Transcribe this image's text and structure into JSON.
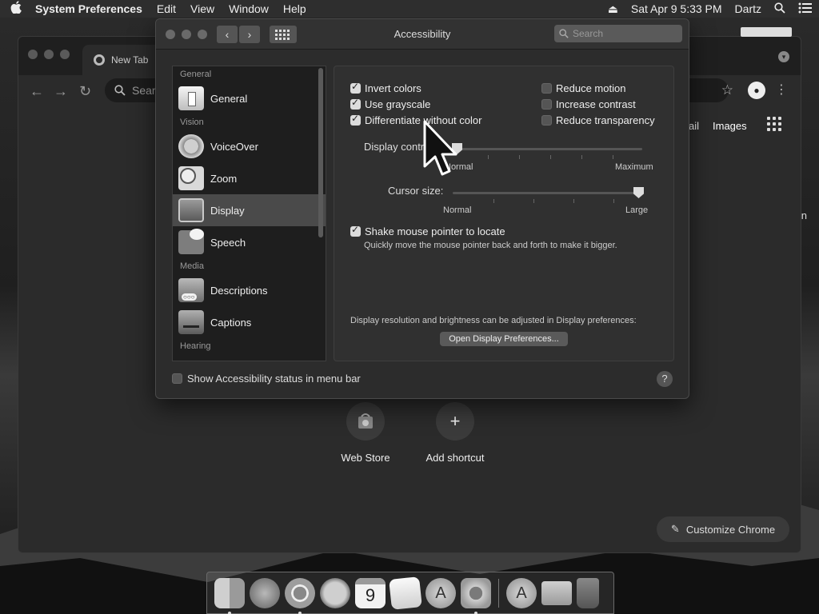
{
  "menubar": {
    "app_name": "System Preferences",
    "menus": [
      "Edit",
      "View",
      "Window",
      "Help"
    ],
    "datetime": "Sat Apr 9  5:33 PM",
    "user": "Dartz"
  },
  "chrome": {
    "tab_title": "New Tab",
    "omnibox_placeholder": "Sear",
    "gmail_partial": "ail",
    "images_link": "Images",
    "edge_fragment": "n",
    "shortcuts": [
      {
        "label": "Web Store",
        "icon": "web-store-icon"
      },
      {
        "label": "Add shortcut",
        "icon": "plus-icon",
        "glyph": "+"
      }
    ],
    "customize_label": "Customize Chrome"
  },
  "prefs": {
    "window_title": "Accessibility",
    "search_placeholder": "Search",
    "sidebar": [
      {
        "type": "header",
        "label": "General"
      },
      {
        "type": "item",
        "label": "General",
        "icon": "general-icon",
        "selected": false
      },
      {
        "type": "header",
        "label": "Vision"
      },
      {
        "type": "item",
        "label": "VoiceOver",
        "icon": "voiceover-icon",
        "selected": false
      },
      {
        "type": "item",
        "label": "Zoom",
        "icon": "zoom-icon",
        "selected": false
      },
      {
        "type": "item",
        "label": "Display",
        "icon": "display-icon",
        "selected": true
      },
      {
        "type": "item",
        "label": "Speech",
        "icon": "speech-icon",
        "selected": false
      },
      {
        "type": "header",
        "label": "Media"
      },
      {
        "type": "item",
        "label": "Descriptions",
        "icon": "descriptions-icon",
        "selected": false
      },
      {
        "type": "item",
        "label": "Captions",
        "icon": "captions-icon",
        "selected": false
      },
      {
        "type": "header",
        "label": "Hearing"
      }
    ],
    "options_left": [
      {
        "label": "Invert colors",
        "checked": true
      },
      {
        "label": "Use grayscale",
        "checked": true
      },
      {
        "label": "Differentiate without color",
        "checked": true
      }
    ],
    "options_right": [
      {
        "label": "Reduce motion",
        "checked": false
      },
      {
        "label": "Increase contrast",
        "checked": false
      },
      {
        "label": "Reduce transparency",
        "checked": false
      }
    ],
    "display_contrast": {
      "label": "Display contrast:",
      "min_label": "Normal",
      "max_label": "Maximum",
      "value": 0.0
    },
    "cursor_size": {
      "label": "Cursor size:",
      "min_label": "Normal",
      "max_label": "Large",
      "value": 1.0
    },
    "shake": {
      "label": "Shake mouse pointer to locate",
      "checked": true,
      "description": "Quickly move the mouse pointer back and forth to make it bigger."
    },
    "resolution_note": "Display resolution and brightness can be adjusted in Display preferences:",
    "open_display_button": "Open Display Preferences...",
    "status_menu": {
      "label": "Show Accessibility status in menu bar",
      "checked": false
    },
    "help_glyph": "?"
  },
  "dock": {
    "apps": [
      {
        "name": "finder-icon",
        "running": true
      },
      {
        "name": "launchpad-icon",
        "running": false
      },
      {
        "name": "chrome-icon",
        "running": true
      },
      {
        "name": "safari-icon",
        "running": false
      },
      {
        "name": "calendar-icon",
        "running": false,
        "text": "9"
      },
      {
        "name": "notes-icon",
        "running": false
      },
      {
        "name": "app-store-icon",
        "running": false
      },
      {
        "name": "system-preferences-icon",
        "running": true
      }
    ],
    "right": [
      "app-store-downloads-icon",
      "downloads-folder-icon",
      "trash-icon"
    ]
  }
}
